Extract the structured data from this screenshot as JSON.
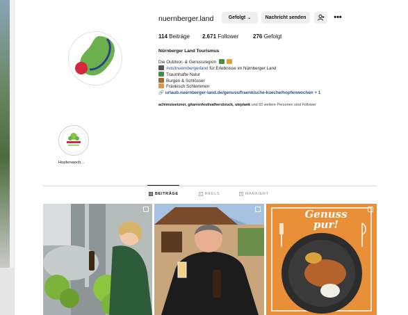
{
  "profile": {
    "username": "nuernberger.land",
    "follow_button": "Gefolgt",
    "message_button": "Nachricht senden",
    "stats": {
      "posts_value": "114",
      "posts_label": "Beiträge",
      "followers_value": "2.671",
      "followers_label": "Follower",
      "following_value": "276",
      "following_label": "Gefolgt"
    },
    "bio": {
      "name": "Nürnberger Land Tourismus",
      "line1": "Die Outdoor- & Genussregion",
      "line2_hashtag": "#visitnuernbergerland",
      "line2_rest": " für Erlebnisse im Nürnberger Land",
      "line3": "Traumhafte Natur",
      "line4": "Burgen & Schlösser",
      "line5": "Fränkisch Schlemmen",
      "link": "urlaub.nuernberger-land.de/genuss/fraenkische-kueche/hopfenwochen + 1"
    },
    "followed_by_names": "achimstoetzner, gitarrenfestivalhersbruck, uteplank",
    "followed_by_rest": " und 93 weitere Personen sind Follower"
  },
  "highlight": {
    "label": "Hopfenwoch..."
  },
  "tabs": [
    {
      "label": "BEITRÄGE"
    },
    {
      "label": "REELS"
    },
    {
      "label": "MARKIERT"
    }
  ],
  "posts": {
    "post3_title_1": "Genuss",
    "post3_title_2": "pur!"
  },
  "colors": {
    "link_blue": "#284a93",
    "logo_green": "#6ab04c",
    "logo_red": "#d7263d"
  }
}
